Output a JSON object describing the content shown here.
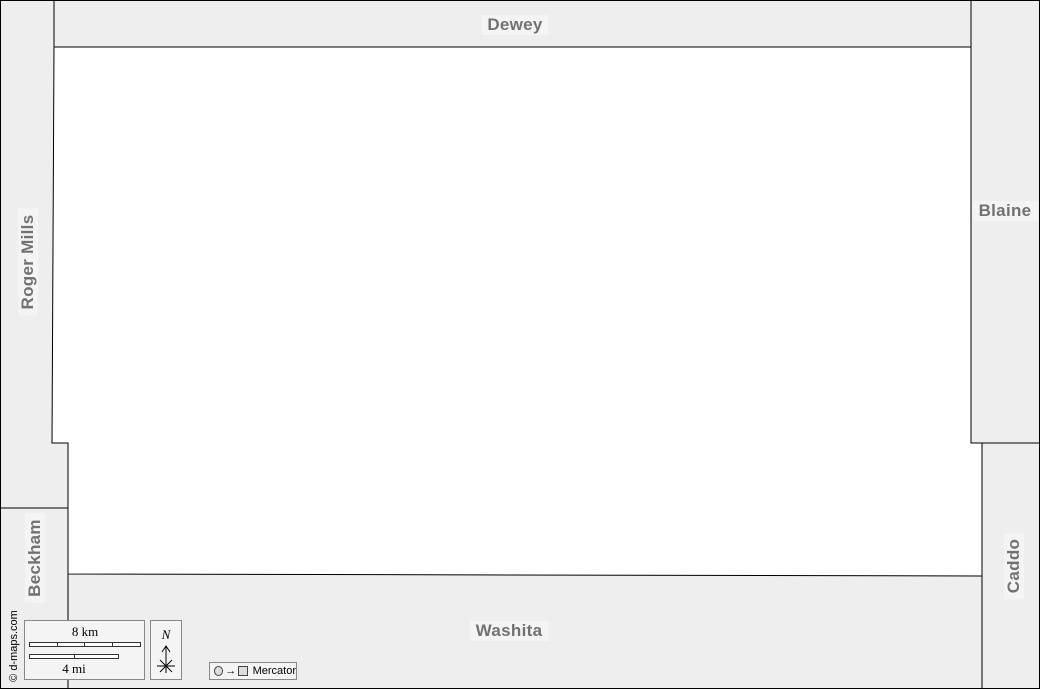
{
  "map": {
    "counties": {
      "north": "Dewey",
      "east_upper": "Blaine",
      "east_lower": "Caddo",
      "south": "Washita",
      "west_upper": "Roger Mills",
      "west_lower": "Beckham"
    },
    "colors": {
      "neighbor_fill": "#eeeeee",
      "focus_fill": "#ffffff",
      "border": "#000000",
      "label_text": "#727272",
      "label_bg": "#f4f4f4"
    },
    "copyright": "© d-maps.com",
    "scale": {
      "km_label": "8 km",
      "mi_label": "4 mi"
    },
    "north_arrow": {
      "letter": "N",
      "icon": "north-arrow-icon"
    },
    "projection": {
      "label": "Mercator",
      "icon": "projection-icon"
    }
  }
}
